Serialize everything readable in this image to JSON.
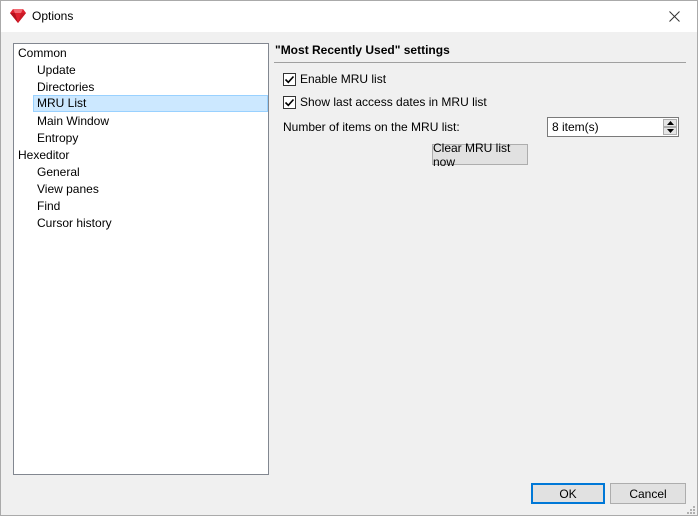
{
  "window": {
    "title": "Options"
  },
  "tree": {
    "items": [
      {
        "label": "Common",
        "level": 0,
        "selected": false
      },
      {
        "label": "Update",
        "level": 1,
        "selected": false
      },
      {
        "label": "Directories",
        "level": 1,
        "selected": false
      },
      {
        "label": "MRU List",
        "level": 1,
        "selected": true
      },
      {
        "label": "Main Window",
        "level": 1,
        "selected": false
      },
      {
        "label": "Entropy",
        "level": 1,
        "selected": false
      },
      {
        "label": "Hexeditor",
        "level": 0,
        "selected": false
      },
      {
        "label": "General",
        "level": 1,
        "selected": false
      },
      {
        "label": "View panes",
        "level": 1,
        "selected": false
      },
      {
        "label": "Find",
        "level": 1,
        "selected": false
      },
      {
        "label": "Cursor history",
        "level": 1,
        "selected": false
      }
    ]
  },
  "settings": {
    "title": "\"Most Recently Used\" settings",
    "enable_mru": {
      "label": "Enable MRU list",
      "checked": true
    },
    "show_dates": {
      "label": "Show last access dates in MRU list",
      "checked": true
    },
    "items_label": "Number of items on the MRU list:",
    "items_value": "8 item(s)",
    "clear_button": "Clear MRU list now"
  },
  "footer": {
    "ok": "OK",
    "cancel": "Cancel"
  },
  "icons": {
    "app": "ruby-gem-icon",
    "close": "close-icon",
    "check": "checkmark-icon",
    "spin_up": "arrow-up-icon",
    "spin_down": "arrow-down-icon"
  },
  "colors": {
    "selection": "#cce8ff",
    "selection_border": "#99d1ff",
    "default_button_border": "#0078d7",
    "app_icon": "#e0202e"
  }
}
